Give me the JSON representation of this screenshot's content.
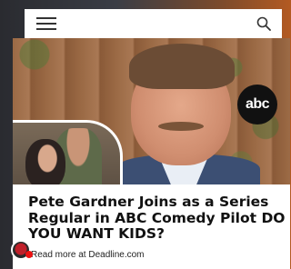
{
  "header": {
    "menu_icon": "hamburger-menu-icon",
    "search_icon": "search-icon"
  },
  "article": {
    "network_logo": "abc",
    "headline": "Pete Gardner Joins as a Series Regular in ABC Comedy Pilot DO YOU WANT KIDS?",
    "read_more": "Read more at Deadline.com"
  },
  "colors": {
    "background_left": "#2a2b30",
    "background_right": "#b35a22",
    "abc_logo_bg": "#111111",
    "headline": "#111111"
  }
}
